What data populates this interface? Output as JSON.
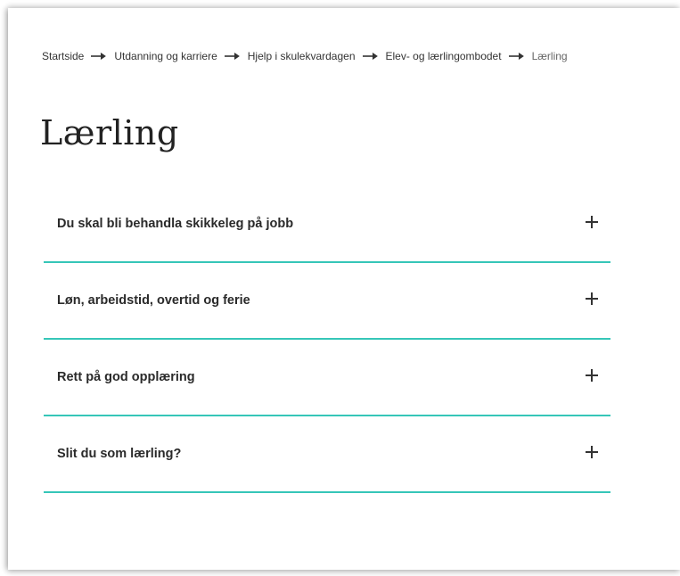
{
  "breadcrumb": {
    "items": [
      {
        "label": "Startside"
      },
      {
        "label": "Utdanning og karriere"
      },
      {
        "label": "Hjelp i skulekvardagen"
      },
      {
        "label": "Elev- og lærlingombodet"
      },
      {
        "label": "Lærling"
      }
    ],
    "separator_icon": "arrow-right-icon"
  },
  "page": {
    "title": "Lærling"
  },
  "accordion": {
    "items": [
      {
        "label": "Du skal bli behandla skikkeleg på jobb",
        "expanded": false
      },
      {
        "label": "Løn, arbeidstid, overtid og ferie",
        "expanded": false
      },
      {
        "label": "Rett på god opplæring",
        "expanded": false
      },
      {
        "label": "Slit du som lærling?",
        "expanded": false
      }
    ],
    "toggle_icon": "plus-icon",
    "divider_color": "#36c6b8"
  }
}
